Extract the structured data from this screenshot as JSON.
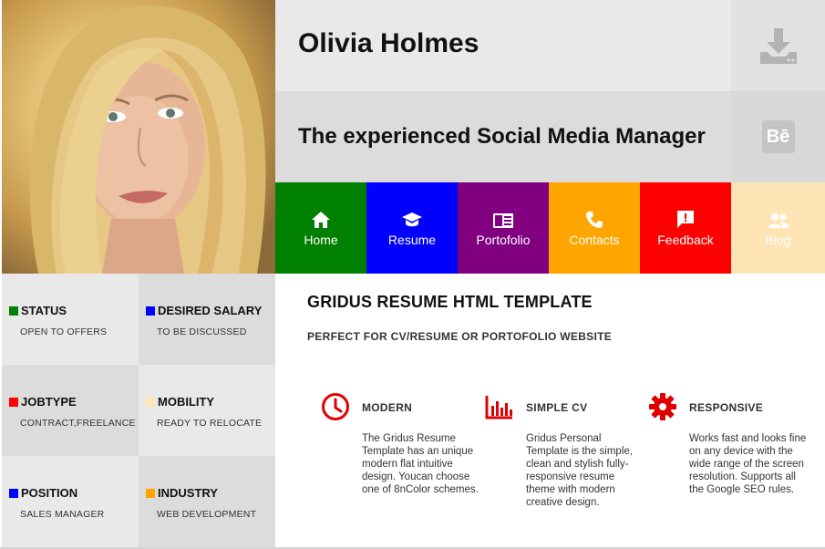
{
  "profile": {
    "name": "Olivia Holmes",
    "title": "The experienced Social Media Manager"
  },
  "side_icons": [
    {
      "icon": "download-icon"
    },
    {
      "icon": "behance-icon",
      "label": "Bē"
    }
  ],
  "nav": [
    {
      "label": "Home",
      "icon": "home-icon",
      "color": "#008000"
    },
    {
      "label": "Resume",
      "icon": "graduation-cap-icon",
      "color": "#0000ff"
    },
    {
      "label": "Portofolio",
      "icon": "portfolio-icon",
      "color": "#800080"
    },
    {
      "label": "Contacts",
      "icon": "phone-icon",
      "color": "#ffa500"
    },
    {
      "label": "Feedback",
      "icon": "feedback-icon",
      "color": "#ff0000"
    },
    {
      "label": "Blog",
      "icon": "users-icon",
      "color": "#ffe4b5"
    }
  ],
  "info": [
    {
      "label": "STATUS",
      "value": "OPEN TO OFFERS",
      "color": "#008000"
    },
    {
      "label": "DESIRED SALARY",
      "value": "TO BE DISCUSSED",
      "color": "#0000ff"
    },
    {
      "label": "JOBTYPE",
      "value": "CONTRACT,FREELANCE",
      "color": "#ff0000"
    },
    {
      "label": "MOBILITY",
      "value": "READY TO RELOCATE",
      "color": "#ffe4b5"
    },
    {
      "label": "POSITION",
      "value": "SALES MANAGER",
      "color": "#0000ff"
    },
    {
      "label": "INDUSTRY",
      "value": "WEB DEVELOPMENT",
      "color": "#ffa500"
    }
  ],
  "main": {
    "heading": "GRIDUS RESUME HTML TEMPLATE",
    "subheading": "PERFECT FOR CV/RESUME OR PORTOFOLIO WEBSITE",
    "accent": "#e00000",
    "features": [
      {
        "title": "MODERN",
        "icon": "clock-icon",
        "text": "The Gridus Resume Template has an unique modern flat intuitive design. Youcan choose one of 8nColor schemes."
      },
      {
        "title": "SIMPLE CV",
        "icon": "bar-chart-icon",
        "text": "Gridus Personal Template is the simple, clean and stylish fully-responsive resume theme with modern creative design."
      },
      {
        "title": "RESPONSIVE",
        "icon": "gear-icon",
        "text": "Works fast and looks fine on any device with the wide range of the screen resolution. Supports all the Google SEO rules."
      }
    ]
  }
}
